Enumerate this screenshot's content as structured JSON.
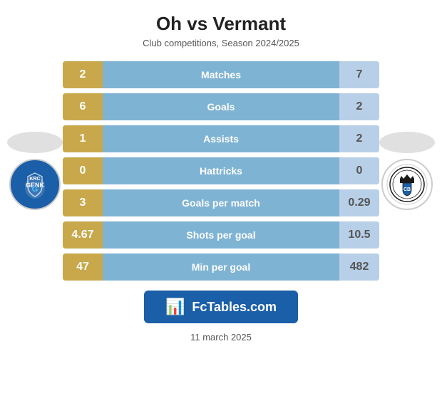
{
  "header": {
    "title": "Oh vs Vermant",
    "subtitle": "Club competitions, Season 2024/2025"
  },
  "stats": [
    {
      "label": "Matches",
      "left": "2",
      "right": "7"
    },
    {
      "label": "Goals",
      "left": "6",
      "right": "2"
    },
    {
      "label": "Assists",
      "left": "1",
      "right": "2"
    },
    {
      "label": "Hattricks",
      "left": "0",
      "right": "0"
    },
    {
      "label": "Goals per match",
      "left": "3",
      "right": "0.29"
    },
    {
      "label": "Shots per goal",
      "left": "4.67",
      "right": "10.5"
    },
    {
      "label": "Min per goal",
      "left": "47",
      "right": "482"
    }
  ],
  "banner": {
    "icon": "📊",
    "text": "FcTables.com"
  },
  "footer": {
    "date": "11 march 2025"
  },
  "colors": {
    "gold": "#c8a84b",
    "blue": "#7fb3d3",
    "lightBlue": "#b8cfe8",
    "darkBlue": "#1a5fa8"
  }
}
